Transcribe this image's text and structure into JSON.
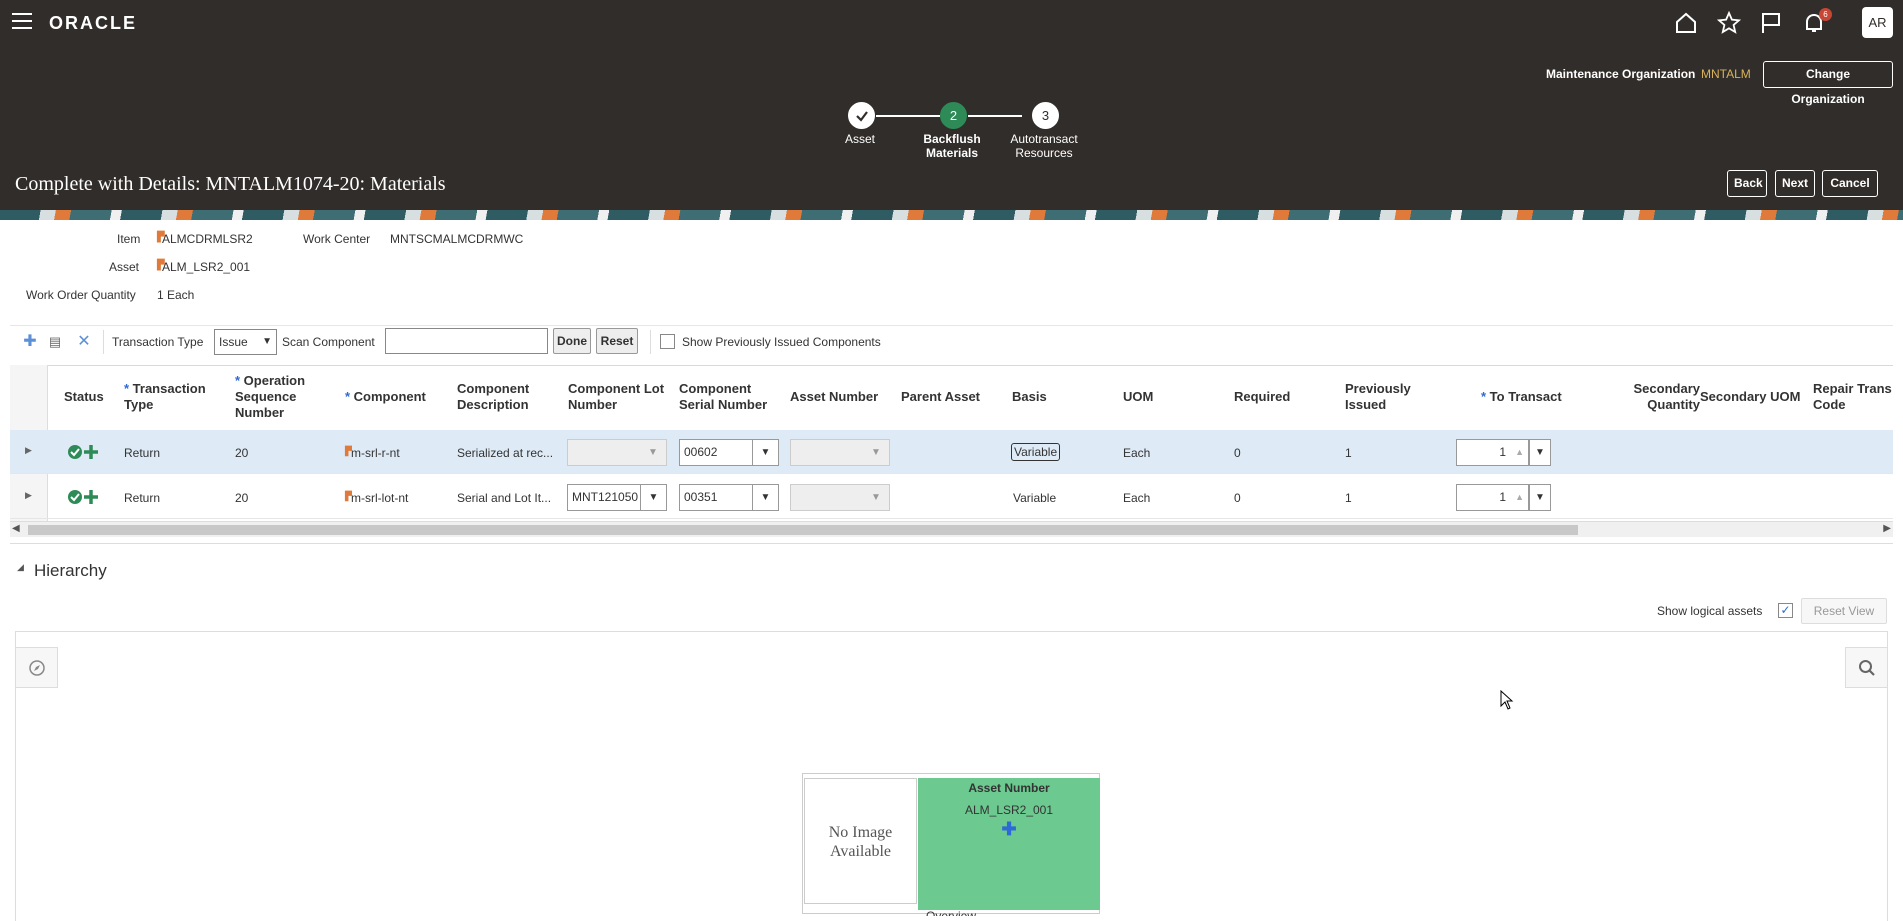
{
  "app": {
    "logo": "ORACLE",
    "notification_count": "6",
    "avatar_initials": "AR"
  },
  "org": {
    "label": "Maintenance Organization",
    "value": "MNTALM",
    "change_button": "Change Organization"
  },
  "train": [
    {
      "number": "✓",
      "label": "Asset"
    },
    {
      "number": "2",
      "label": "Backflush Materials"
    },
    {
      "number": "3",
      "label": "Autotransact Resources"
    }
  ],
  "page": {
    "title": "Complete with Details: MNTALM1074-20: Materials",
    "back": "Back",
    "next": "Next",
    "cancel": "Cancel"
  },
  "details": {
    "item_label": "Item",
    "item_value": "ALMCDRMLSR2",
    "work_center_label": "Work Center",
    "work_center_value": "MNTSCMALMCDRMWC",
    "asset_label": "Asset",
    "asset_value": "ALM_LSR2_001",
    "qty_label": "Work Order Quantity",
    "qty_value": "1 Each"
  },
  "toolbar": {
    "transaction_type_label": "Transaction Type",
    "transaction_type_value": "Issue",
    "scan_label": "Scan Component",
    "done": "Done",
    "reset": "Reset",
    "show_prev_label": "Show Previously Issued Components"
  },
  "columns": {
    "status": "Status",
    "txn_type": "Transaction Type",
    "op_seq": "Operation Sequence Number",
    "component": "Component",
    "comp_desc": "Component Description",
    "lot": "Component Lot Number",
    "serial": "Component Serial Number",
    "asset_num": "Asset Number",
    "parent": "Parent Asset",
    "basis": "Basis",
    "uom": "UOM",
    "required": "Required",
    "prev_issued": "Previously Issued",
    "to_transact": "To Transact",
    "sec_qty": "Secondary Quantity",
    "sec_uom": "Secondary UOM",
    "repair": "Repair Trans Code"
  },
  "rows": [
    {
      "txn_type": "Return",
      "op_seq": "20",
      "component": "m-srl-r-nt",
      "comp_desc": "Serialized at rec...",
      "lot": "",
      "serial": "00602",
      "basis": "Variable",
      "uom": "Each",
      "required": "0",
      "prev_issued": "1",
      "to_transact": "1"
    },
    {
      "txn_type": "Return",
      "op_seq": "20",
      "component": "m-srl-lot-nt",
      "comp_desc": "Serial and Lot It...",
      "lot": "MNT121050",
      "serial": "00351",
      "basis": "Variable",
      "uom": "Each",
      "required": "0",
      "prev_issued": "1",
      "to_transact": "1"
    }
  ],
  "hierarchy": {
    "title": "Hierarchy",
    "show_logical": "Show logical assets",
    "reset_view": "Reset View",
    "card_no_image": "No Image Available",
    "card_asset_label": "Asset Number",
    "card_asset_value": "ALM_LSR2_001",
    "card_footer": "Overview"
  },
  "colors": {
    "header_bg": "#312d2a",
    "accent": "#2e8b57",
    "card_green": "#6cc98f"
  }
}
